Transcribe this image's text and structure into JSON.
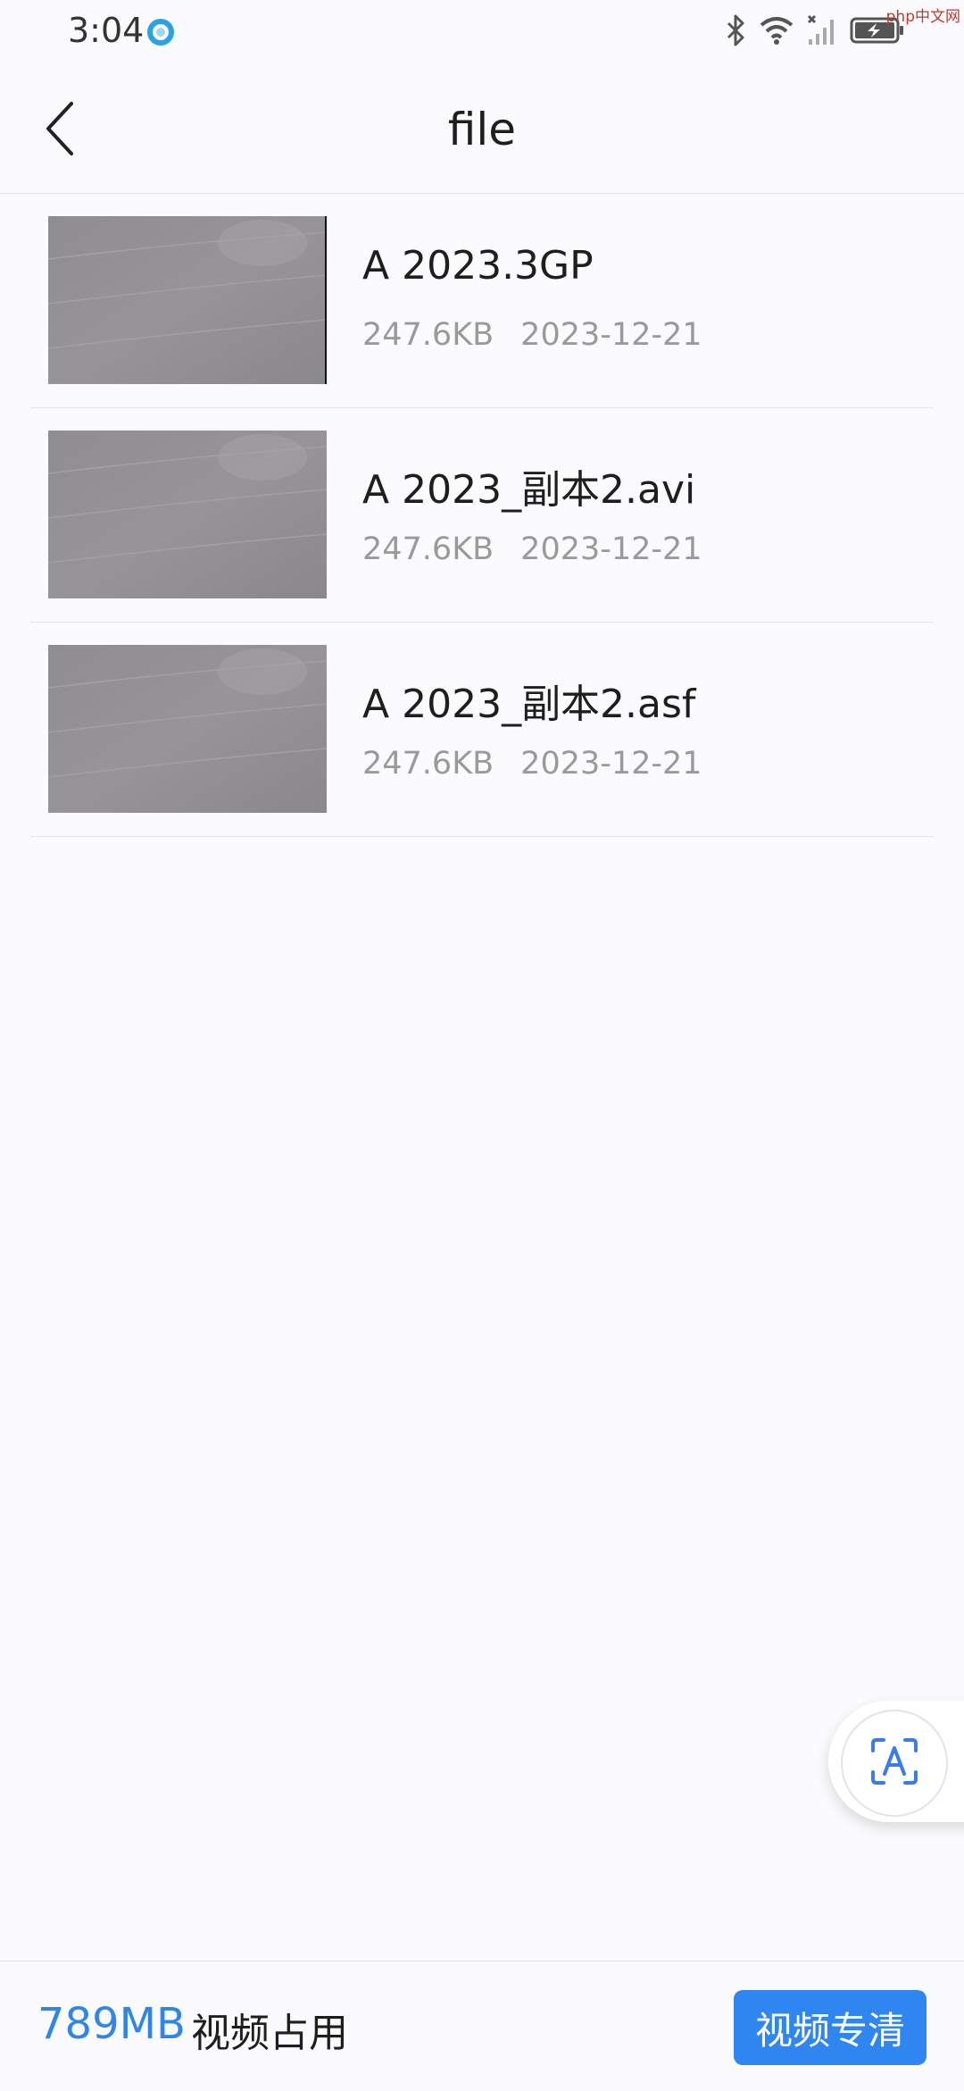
{
  "status_bar": {
    "time": "3:04",
    "app_icon": "blue-circle-icon",
    "icons": [
      "bluetooth-icon",
      "wifi-icon",
      "signal-icon",
      "battery-charging-icon"
    ],
    "watermark": "php中文网"
  },
  "header": {
    "back_icon": "chevron-left-icon",
    "title": "file"
  },
  "files": [
    {
      "name": "A 2023.3GP",
      "size": "247.6KB",
      "date": "2023-12-21"
    },
    {
      "name": "A 2023_副本2.avi",
      "size": "247.6KB",
      "date": "2023-12-21"
    },
    {
      "name": "A 2023_副本2.asf",
      "size": "247.6KB",
      "date": "2023-12-21"
    }
  ],
  "float_button": {
    "icon": "text-scan-icon"
  },
  "bottom_bar": {
    "usage_value": "789MB",
    "usage_label": "视频占用",
    "action_label": "视频专清"
  },
  "colors": {
    "accent": "#2f86f0",
    "usage_text": "#2f86e6",
    "background": "#fbfbfd"
  }
}
